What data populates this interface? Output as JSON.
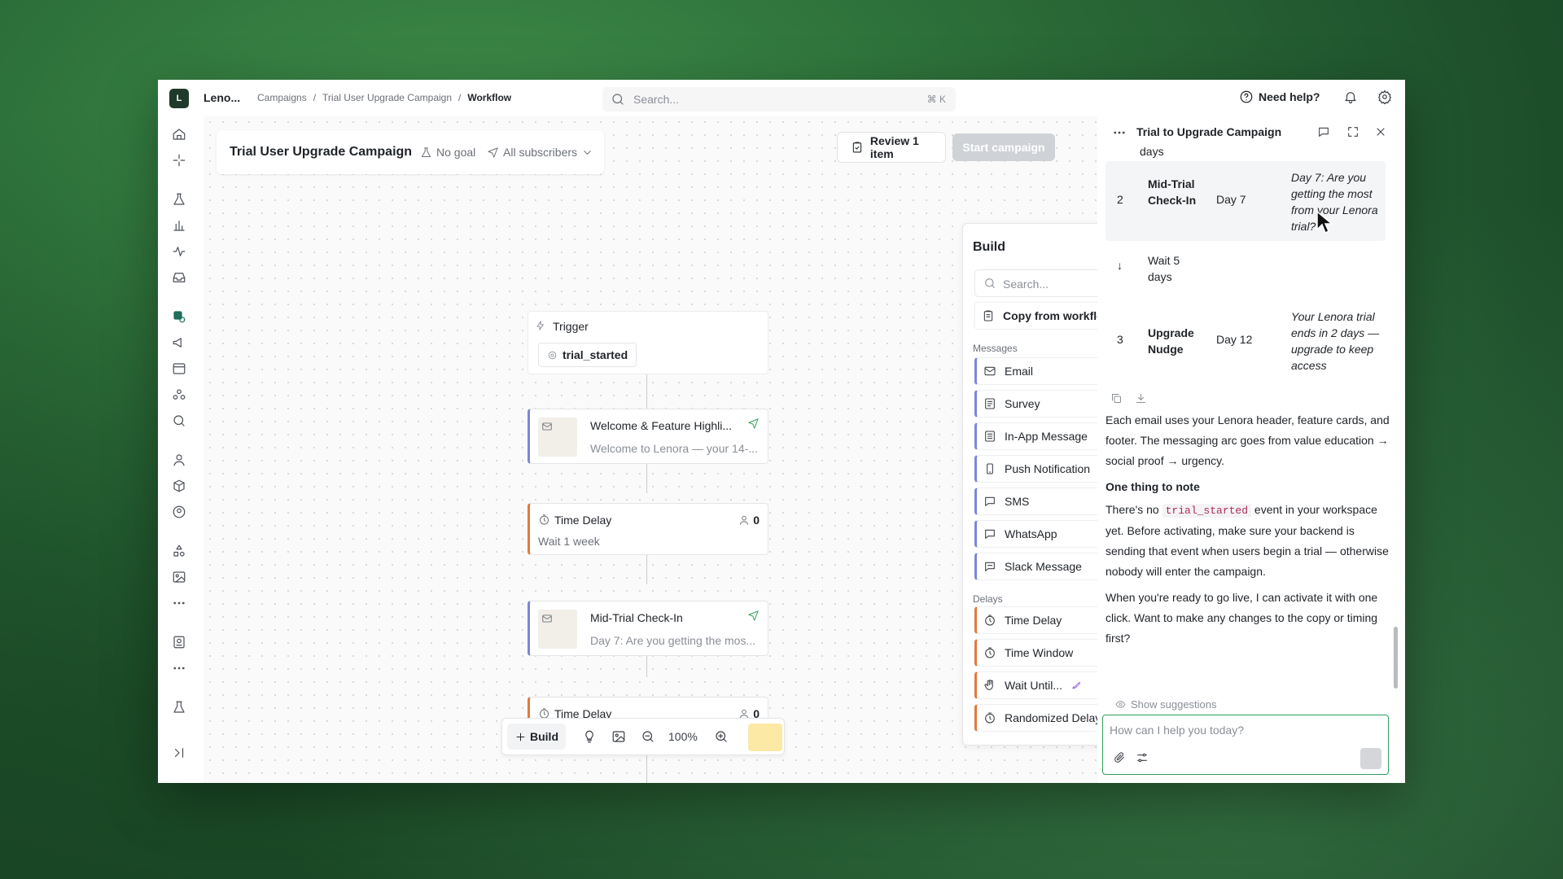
{
  "topbar": {
    "logo": "L",
    "workspace": "Leno...",
    "breadcrumbs": [
      "Campaigns",
      "/",
      "Trial User Upgrade Campaign",
      "/",
      "Workflow"
    ],
    "search_placeholder": "Search...",
    "search_shortcut": "⌘ K",
    "help_label": "Need help?"
  },
  "campaign": {
    "title": "Trial User Upgrade Campaign",
    "goal": "No goal",
    "audience": "All subscribers",
    "review_label": "Review 1 item",
    "start_label": "Start campaign"
  },
  "workflow": {
    "trigger_label": "Trigger",
    "trigger_event": "trial_started",
    "msg1_title": "Welcome & Feature Highli...",
    "msg1_preview": "Welcome to Lenora — your 14-...",
    "delay1_title": "Time Delay",
    "delay1_count": "0",
    "delay1_sub": "Wait 1 week",
    "msg2_title": "Mid-Trial Check-In",
    "msg2_preview": "Day 7: Are you getting the mos...",
    "delay2_title": "Time Delay",
    "delay2_count": "0"
  },
  "toolbar": {
    "build_label": "Build",
    "zoom": "100%"
  },
  "build_panel": {
    "title": "Build",
    "search_placeholder": "Search...",
    "copy_label": "Copy from workflow",
    "messages_heading": "Messages",
    "messages": [
      "Email",
      "Survey",
      "In-App Message",
      "Push Notification",
      "SMS",
      "WhatsApp",
      "Slack Message"
    ],
    "delays_heading": "Delays",
    "delays": [
      "Time Delay",
      "Time Window",
      "Wait Until...",
      "Randomized Delay"
    ]
  },
  "chat": {
    "title": "Trial to Upgrade Campaign",
    "top_cut": "days",
    "rows": [
      {
        "n": "2",
        "name": "Mid-Trial Check-In",
        "day": "Day 7",
        "subject": "Day 7: Are you getting the most from your Lenora trial?"
      },
      {
        "wait": "Wait 5 days"
      },
      {
        "n": "3",
        "name": "Upgrade Nudge",
        "day": "Day 12",
        "subject": "Your Lenora trial ends in 2 days — upgrade to keep access"
      }
    ],
    "p1": "Each email uses your Lenora header, feature cards, and footer. The messaging arc goes from value education → social proof → urgency.",
    "note_heading": "One thing to note",
    "p2_a": "There's no ",
    "p2_code": "trial_started",
    "p2_b": " event in your workspace yet. Before activating, make sure your backend is sending that event when users begin a trial — otherwise nobody will enter the campaign.",
    "p3": "When you're ready to go live, I can activate it with one click. Want to make any changes to the copy or timing first?",
    "suggestions_label": "Show suggestions",
    "input_placeholder": "How can I help you today?"
  }
}
